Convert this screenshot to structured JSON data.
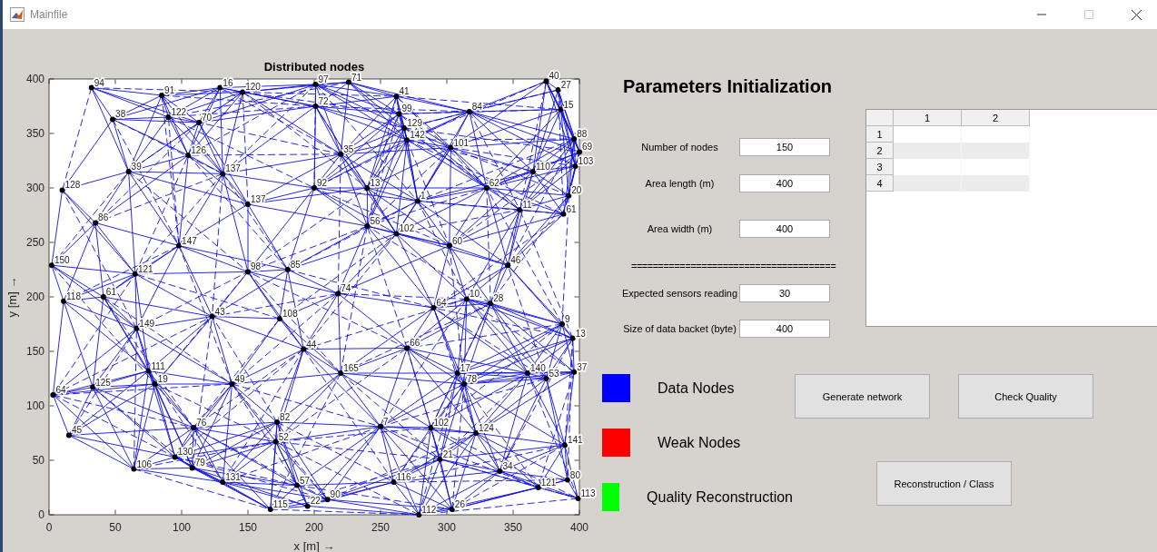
{
  "window": {
    "title": "Mainfile"
  },
  "plot": {
    "chart_data": {
      "type": "scatter",
      "title": "Distributed nodes",
      "xlabel": "x  [m] →",
      "ylabel": "y  [m] →",
      "xlim": [
        0,
        400
      ],
      "ylim": [
        0,
        400
      ],
      "xticks": [
        {
          "value": 0,
          "label": "0"
        },
        {
          "value": 50,
          "label": "50"
        },
        {
          "value": 100,
          "label": "100"
        },
        {
          "value": 150,
          "label": "150"
        },
        {
          "value": 200,
          "label": "200"
        },
        {
          "value": 250,
          "label": "250"
        },
        {
          "value": 300,
          "label": "300"
        },
        {
          "value": 350,
          "label": "350"
        },
        {
          "value": 400,
          "label": "400"
        }
      ],
      "yticks": [
        {
          "value": 0,
          "label": "0"
        },
        {
          "value": 50,
          "label": "50"
        },
        {
          "value": 100,
          "label": "100"
        },
        {
          "value": 150,
          "label": "150"
        },
        {
          "value": 200,
          "label": "200"
        },
        {
          "value": 250,
          "label": "250"
        },
        {
          "value": 300,
          "label": "300"
        },
        {
          "value": 350,
          "label": "350"
        },
        {
          "value": 400,
          "label": "400"
        }
      ],
      "x": [
        32,
        85,
        129,
        146,
        201,
        226,
        262,
        375,
        384,
        386,
        317,
        201,
        264,
        268,
        270,
        303,
        396,
        400,
        397,
        220,
        131,
        392,
        388,
        278,
        2,
        11,
        41,
        387,
        395,
        396,
        333,
        315,
        192,
        220,
        138,
        75,
        80,
        33,
        3,
        15,
        109,
        250,
        288,
        322,
        389,
        295,
        95,
        108,
        64,
        131,
        187,
        167,
        195,
        210,
        279,
        304,
        391,
        399,
        369,
        172,
        171,
        123,
        174,
        66,
        65,
        218,
        270,
        48,
        113,
        361,
        375,
        313,
        308,
        302,
        346,
        10,
        35,
        98,
        60,
        90,
        105,
        150,
        180,
        200,
        240,
        262,
        290,
        330,
        365,
        355,
        150,
        260,
        340,
        240
      ],
      "series": [
        {
          "color": "#000000",
          "values": [
            392,
            385,
            392,
            388,
            395,
            397,
            384,
            398,
            390,
            372,
            370,
            375,
            368,
            355,
            344,
            337,
            345,
            333,
            320,
            331,
            313,
            293,
            276,
            288,
            229,
            196,
            200,
            175,
            162,
            131,
            194,
            198,
            152,
            130,
            120,
            132,
            120,
            117,
            110,
            73,
            80,
            81,
            80,
            75,
            64,
            51,
            53,
            43,
            42,
            30,
            27,
            5,
            8,
            14,
            0,
            5,
            32,
            15,
            25,
            85,
            67,
            182,
            180,
            171,
            221,
            203,
            153,
            363,
            360,
            130,
            125,
            120,
            130,
            247,
            229,
            298,
            268,
            247,
            315,
            365,
            330,
            285,
            225,
            300,
            265,
            258,
            190,
            300,
            315,
            280,
            223,
            30,
            40,
            300
          ]
        }
      ],
      "value_labels": [
        "94",
        "91",
        "16",
        "120",
        "97",
        "71",
        "41",
        "40",
        "27",
        "15",
        "84",
        "72",
        "99",
        "129",
        "142",
        "101",
        "88",
        "69",
        "103",
        "35",
        "137",
        "20",
        "61",
        "1",
        "150",
        "118",
        "61",
        "9",
        "13",
        "37",
        "28",
        "10",
        "44",
        "165",
        "49",
        "111",
        "19",
        "125",
        "64",
        "45",
        "76",
        "7",
        "102",
        "124",
        "141",
        "21",
        "130",
        "79",
        "106",
        "131",
        "57",
        "115",
        "22",
        "90",
        "112",
        "26",
        "80",
        "113",
        "121",
        "82",
        "52",
        "43",
        "108",
        "149",
        "121",
        "74",
        "66",
        "38",
        "70",
        "140",
        "53",
        "78",
        "17",
        "60",
        "46",
        "128",
        "86",
        "147",
        "39",
        "122",
        "126",
        "137",
        "85",
        "92",
        "56",
        "102",
        "64",
        "62",
        "110",
        "11",
        "98",
        "116",
        "34",
        "13"
      ]
    }
  },
  "panel": {
    "title": "Parameters Initialization",
    "parameters": [
      {
        "label": "Number of nodes",
        "value": "150"
      },
      {
        "label": "Area length (m)",
        "value": "400"
      },
      {
        "label": "Area width (m)",
        "value": "400"
      },
      {
        "kind": "separator",
        "label": "======================================"
      },
      {
        "label": "Expected sensors reading",
        "value": "30"
      },
      {
        "label": "Size of data backet (byte)",
        "value": "400"
      }
    ],
    "table": {
      "columns": [
        "1",
        "2"
      ],
      "rows": [
        "1",
        "2",
        "3",
        "4"
      ]
    }
  },
  "legend": [
    {
      "label": "Data Nodes",
      "color": "#0000ff"
    },
    {
      "label": "Weak Nodes",
      "color": "#ff0000"
    },
    {
      "label": "Quality Reconstruction",
      "color": "#00ff00"
    }
  ],
  "buttons": [
    "Generate network",
    "Check Quality",
    "Reconstruction / Class"
  ]
}
